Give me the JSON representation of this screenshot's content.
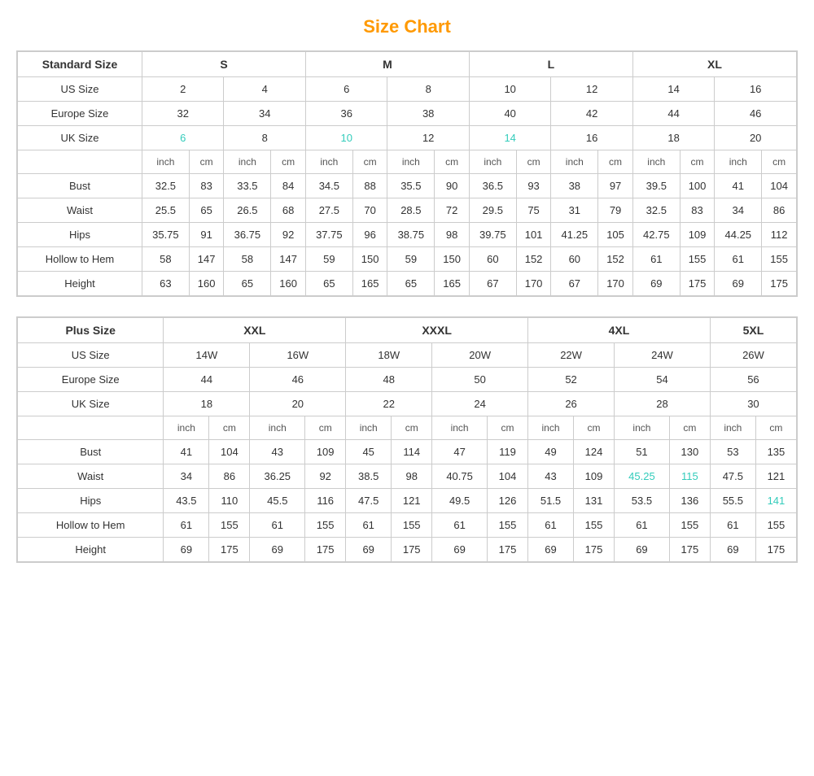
{
  "title": "Size Chart",
  "standard_table": {
    "title": "Standard Size",
    "size_groups": [
      "S",
      "M",
      "L",
      "XL"
    ],
    "us_sizes": [
      "2",
      "4",
      "6",
      "8",
      "10",
      "12",
      "14",
      "16"
    ],
    "europe_sizes": [
      "32",
      "34",
      "36",
      "38",
      "40",
      "42",
      "44",
      "46"
    ],
    "uk_sizes": [
      "6",
      "8",
      "10",
      "12",
      "14",
      "16",
      "18",
      "20"
    ],
    "measurements": {
      "bust": [
        "32.5",
        "83",
        "33.5",
        "84",
        "34.5",
        "88",
        "35.5",
        "90",
        "36.5",
        "93",
        "38",
        "97",
        "39.5",
        "100",
        "41",
        "104"
      ],
      "waist": [
        "25.5",
        "65",
        "26.5",
        "68",
        "27.5",
        "70",
        "28.5",
        "72",
        "29.5",
        "75",
        "31",
        "79",
        "32.5",
        "83",
        "34",
        "86"
      ],
      "hips": [
        "35.75",
        "91",
        "36.75",
        "92",
        "37.75",
        "96",
        "38.75",
        "98",
        "39.75",
        "101",
        "41.25",
        "105",
        "42.75",
        "109",
        "44.25",
        "112"
      ],
      "hollow_to_hem": [
        "58",
        "147",
        "58",
        "147",
        "59",
        "150",
        "59",
        "150",
        "60",
        "152",
        "60",
        "152",
        "61",
        "155",
        "61",
        "155"
      ],
      "height": [
        "63",
        "160",
        "65",
        "160",
        "65",
        "165",
        "65",
        "165",
        "67",
        "170",
        "67",
        "170",
        "69",
        "175",
        "69",
        "175"
      ]
    }
  },
  "plus_table": {
    "title": "Plus Size",
    "size_groups": [
      "XXL",
      "XXXL",
      "4XL",
      "5XL"
    ],
    "us_sizes": [
      "14W",
      "16W",
      "18W",
      "20W",
      "22W",
      "24W",
      "26W"
    ],
    "europe_sizes": [
      "44",
      "46",
      "48",
      "50",
      "52",
      "54",
      "56"
    ],
    "uk_sizes": [
      "18",
      "20",
      "22",
      "24",
      "26",
      "28",
      "30"
    ],
    "measurements": {
      "bust": [
        "41",
        "104",
        "43",
        "109",
        "45",
        "114",
        "47",
        "119",
        "49",
        "124",
        "51",
        "130",
        "53",
        "135"
      ],
      "waist": [
        "34",
        "86",
        "36.25",
        "92",
        "38.5",
        "98",
        "40.75",
        "104",
        "43",
        "109",
        "45.25",
        "115",
        "47.5",
        "121"
      ],
      "hips": [
        "43.5",
        "110",
        "45.5",
        "116",
        "47.5",
        "121",
        "49.5",
        "126",
        "51.5",
        "131",
        "53.5",
        "136",
        "55.5",
        "141"
      ],
      "hollow_to_hem": [
        "61",
        "155",
        "61",
        "155",
        "61",
        "155",
        "61",
        "155",
        "61",
        "155",
        "61",
        "155",
        "61",
        "155"
      ],
      "height": [
        "69",
        "175",
        "69",
        "175",
        "69",
        "175",
        "69",
        "175",
        "69",
        "175",
        "69",
        "175",
        "69",
        "175"
      ]
    }
  }
}
